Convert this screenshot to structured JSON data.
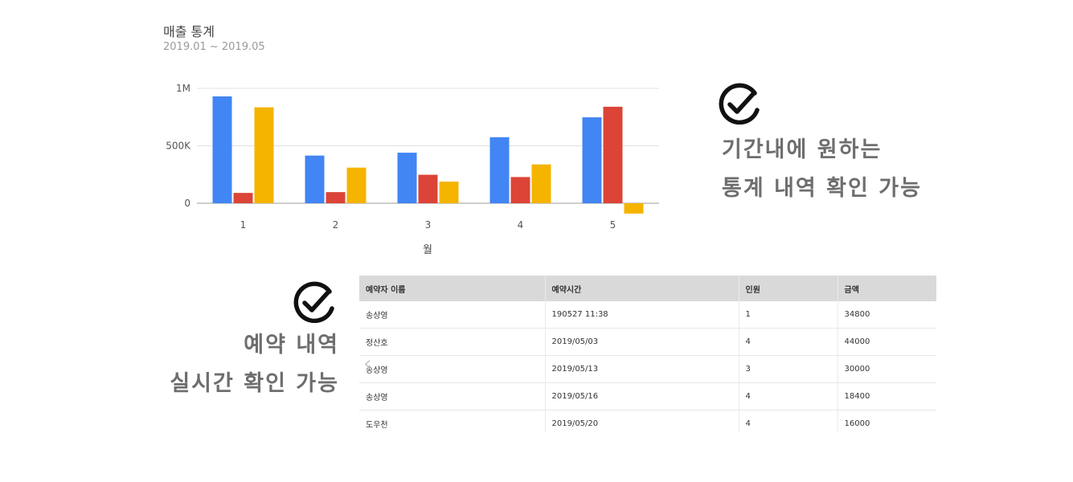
{
  "chart_panel": {
    "title": "매출 통계",
    "subtitle": "2019.01 ~ 2019.05"
  },
  "chart_data": {
    "type": "bar",
    "categories": [
      "1",
      "2",
      "3",
      "4",
      "5"
    ],
    "series": [
      {
        "color": "#4285f4",
        "values": [
          930000,
          415000,
          440000,
          575000,
          748000
        ]
      },
      {
        "color": "#db4437",
        "values": [
          90000,
          97000,
          248000,
          228000,
          840000
        ]
      },
      {
        "color": "#f4b400",
        "values": [
          835000,
          310000,
          188000,
          338000,
          -90000
        ]
      }
    ],
    "xlabel": "월",
    "ylabel": "",
    "ylim": [
      -100000,
      1000000
    ],
    "yticks": [
      0,
      500000,
      1000000
    ],
    "ytick_labels": [
      "0",
      "500K",
      "1M"
    ],
    "grid": true,
    "legend": "none"
  },
  "features": {
    "stats": {
      "line1": "기간내에 원하는",
      "line2": "통계 내역 확인 가능",
      "icon": "check-circle-icon"
    },
    "reservations": {
      "line1": "예약 내역",
      "line2": "실시간 확인 가능",
      "icon": "check-circle-icon"
    }
  },
  "table": {
    "headers": [
      "예약자 이름",
      "예약시간",
      "인원",
      "금액"
    ],
    "rows": [
      [
        "송상영",
        "190527 11:38",
        "1",
        "34800"
      ],
      [
        "정산호",
        "2019/05/03",
        "4",
        "44000"
      ],
      [
        "송상영",
        "2019/05/13",
        "3",
        "30000"
      ],
      [
        "송상영",
        "2019/05/16",
        "4",
        "18400"
      ],
      [
        "도우천",
        "2019/05/20",
        "4",
        "16000"
      ]
    ]
  },
  "pager": {
    "prev_arrow": "‹"
  }
}
